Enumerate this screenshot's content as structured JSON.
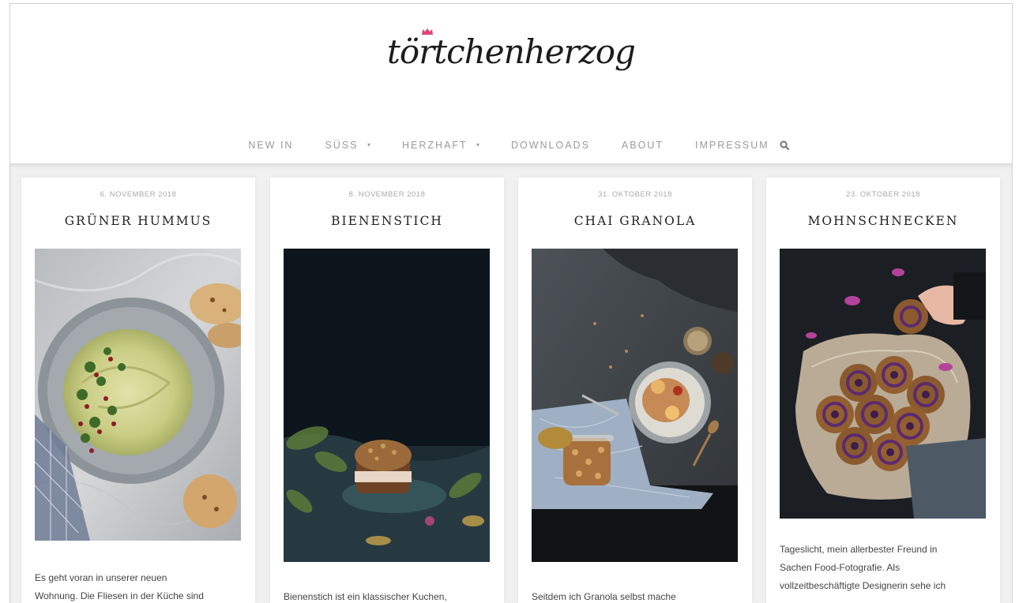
{
  "site": {
    "logo_text": "törtchenherzog"
  },
  "nav": {
    "items": [
      {
        "label": "NEW IN",
        "has_dropdown": false
      },
      {
        "label": "SÜSS",
        "has_dropdown": true
      },
      {
        "label": "HERZHAFT",
        "has_dropdown": true
      },
      {
        "label": "DOWNLOADS",
        "has_dropdown": false
      },
      {
        "label": "ABOUT",
        "has_dropdown": false
      },
      {
        "label": "IMPRESSUM",
        "has_dropdown": false
      }
    ],
    "search_icon": "search-icon",
    "caret_glyph": "▾"
  },
  "posts": [
    {
      "date": "6. NOVEMBER 2018",
      "title": "GRÜNER HUMMUS",
      "excerpt_lines": [
        "Es geht voran in unserer neuen",
        "Wohnung. Die Fliesen in der Küche sind"
      ]
    },
    {
      "date": "8. NOVEMBER 2018",
      "title": "BIENENSTICH",
      "excerpt_lines": [
        "Bienenstich ist ein klassischer Kuchen,"
      ]
    },
    {
      "date": "31. OKTOBER 2018",
      "title": "CHAI GRANOLA",
      "excerpt_lines": [
        "Seitdem ich Granola selbst mache"
      ]
    },
    {
      "date": "23. OKTOBER 2018",
      "title": "MOHNSCHNECKEN",
      "excerpt_lines": [
        "Tageslicht, mein allerbester Freund in",
        "Sachen Food-Fotografie. Als",
        "vollzeitbeschäftigte Designerin sehe ich"
      ]
    }
  ],
  "colors": {
    "crown": "#e0467a",
    "nav_text": "#9a9a9a",
    "background": "#f0f0f0"
  }
}
